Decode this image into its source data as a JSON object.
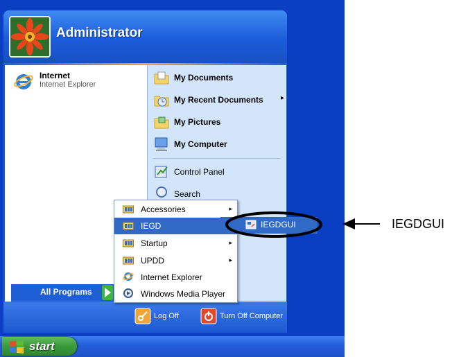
{
  "user": {
    "name": "Administrator"
  },
  "pinned": {
    "title": "Internet",
    "subtitle": "Internet Explorer"
  },
  "right_items": [
    {
      "label": "My Documents",
      "bold": true,
      "icon": "my-documents-icon"
    },
    {
      "label": "My Recent Documents",
      "bold": true,
      "icon": "recent-documents-icon",
      "arrow": "▸"
    },
    {
      "label": "My Pictures",
      "bold": true,
      "icon": "my-pictures-icon"
    },
    {
      "label": "My Computer",
      "bold": true,
      "icon": "my-computer-icon"
    },
    {
      "label": "Control Panel",
      "bold": false,
      "icon": "control-panel-icon"
    },
    {
      "label": "Search",
      "bold": false,
      "icon": "search-icon"
    }
  ],
  "all_programs": {
    "label": "All Programs"
  },
  "programs_menu": [
    {
      "label": "Accessories",
      "icon": "program-folder-icon",
      "arrow": "▸"
    },
    {
      "label": "IEGD",
      "icon": "program-folder-icon",
      "arrow": "",
      "selected": true
    },
    {
      "label": "Startup",
      "icon": "program-folder-icon",
      "arrow": "▸"
    },
    {
      "label": "UPDD",
      "icon": "program-folder-icon",
      "arrow": "▸"
    },
    {
      "label": "Internet Explorer",
      "icon": "internet-explorer-icon",
      "arrow": ""
    },
    {
      "label": "Windows Media Player",
      "icon": "media-player-icon",
      "arrow": ""
    }
  ],
  "iegd_submenu": {
    "label": "IEGDGUI"
  },
  "footer": {
    "log_off": "Log Off",
    "turn_off": "Turn Off Computer"
  },
  "taskbar": {
    "start": "start"
  },
  "callout": {
    "label": "IEGDGUI"
  },
  "colors": {
    "selection": "#316ac5",
    "header_blue": "#1f5fd6",
    "start_green": "#3a9a3a"
  }
}
